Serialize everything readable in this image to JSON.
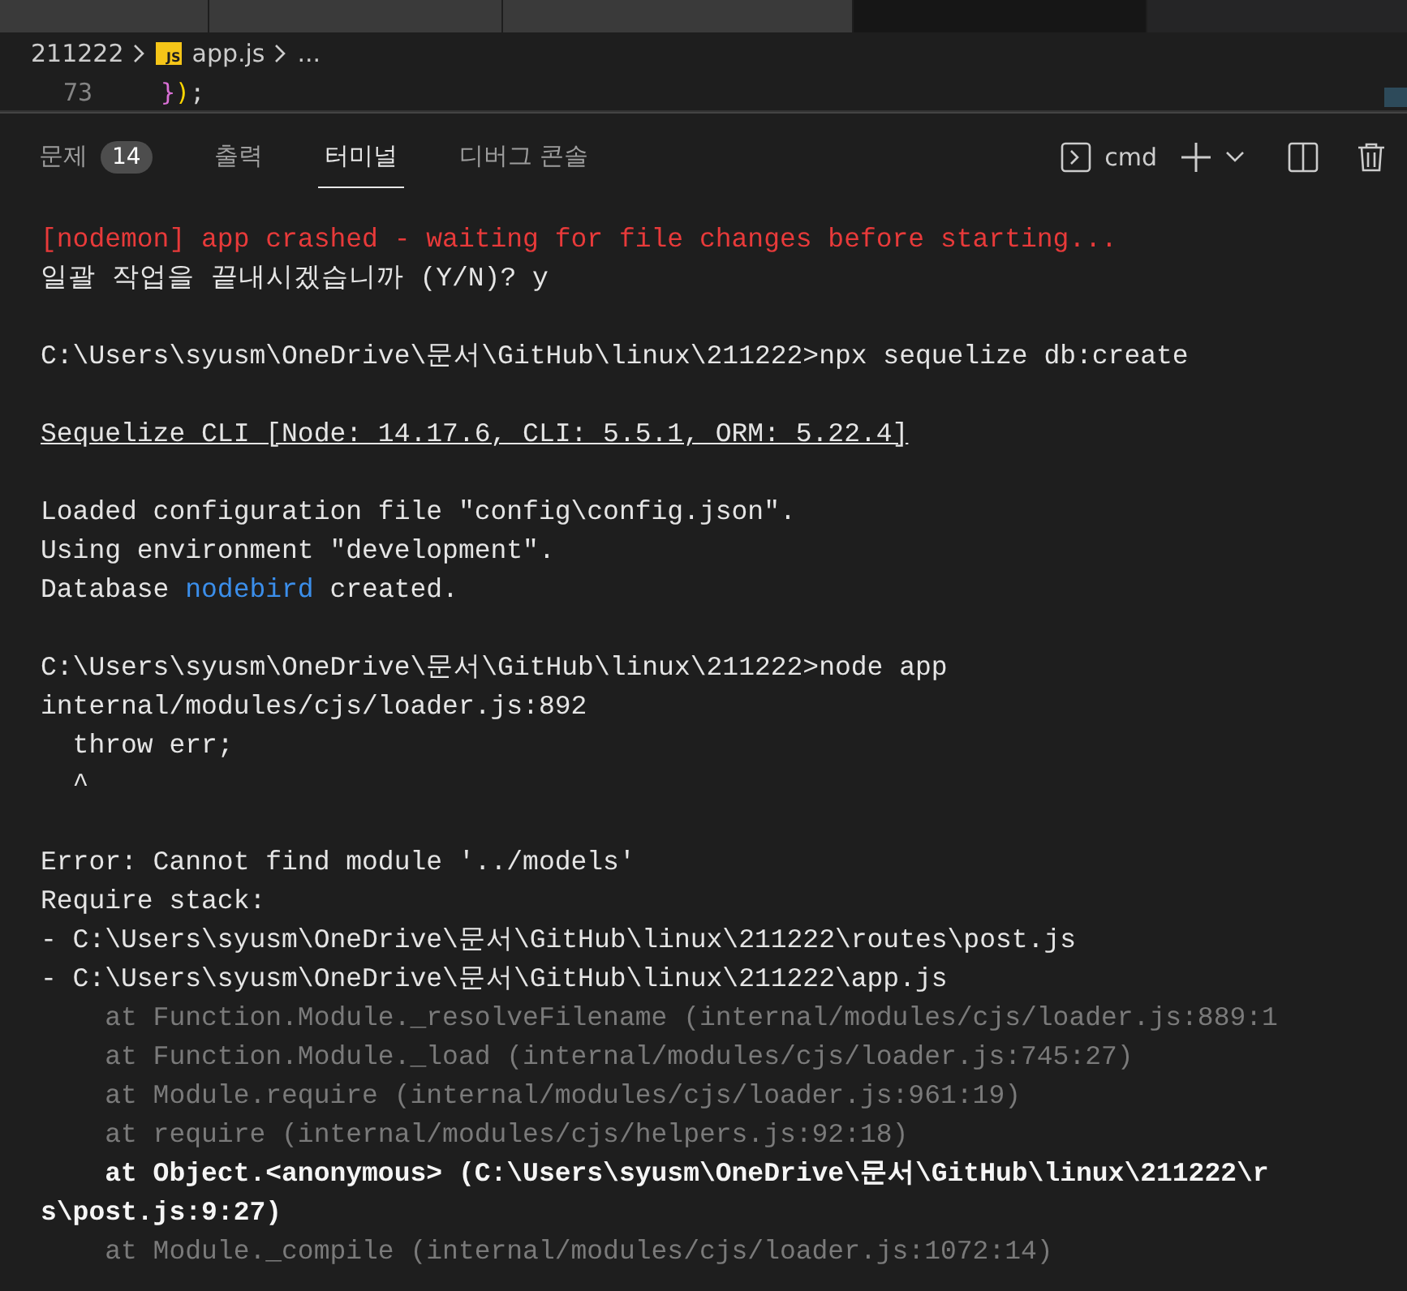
{
  "editor_tabs": [
    {
      "selected": false
    },
    {
      "selected": false
    },
    {
      "selected": false
    },
    {
      "selected": true
    }
  ],
  "breadcrumb": {
    "folder": "211222",
    "file_icon": "JS",
    "file": "app.js",
    "more": "..."
  },
  "code": {
    "line_number": "73",
    "tokens": [
      {
        "text": "}",
        "kind": "brace"
      },
      {
        "text": ")",
        "kind": "paren"
      },
      {
        "text": ";",
        "kind": "plain"
      }
    ]
  },
  "panel_tabs": [
    {
      "label": "문제",
      "badge": "14",
      "selected": false
    },
    {
      "label": "출력",
      "selected": false
    },
    {
      "label": "터미널",
      "selected": true
    },
    {
      "label": "디버그 콘솔",
      "selected": false
    }
  ],
  "terminal_toolbar": {
    "shell": "cmd"
  },
  "terminal_lines": [
    {
      "segments": [
        {
          "text": "[nodemon] app crashed - waiting for file changes before starting...",
          "kind": "error"
        }
      ]
    },
    {
      "segments": [
        {
          "text": "일괄 작업을 끝내시겠습니까 (Y/N)? y",
          "kind": "normal"
        }
      ]
    },
    {
      "kind": "blank"
    },
    {
      "segments": [
        {
          "text": "C:\\Users\\syusm\\OneDrive\\문서\\GitHub\\linux\\211222>npx sequelize db:create",
          "kind": "normal"
        }
      ]
    },
    {
      "kind": "blank"
    },
    {
      "segments": [
        {
          "text": "Sequelize CLI [Node: 14.17.6, CLI: 5.5.1, ORM: 5.22.4]",
          "kind": "underline"
        }
      ]
    },
    {
      "kind": "blank"
    },
    {
      "segments": [
        {
          "text": "Loaded configuration file \"config\\config.json\".",
          "kind": "normal"
        }
      ]
    },
    {
      "segments": [
        {
          "text": "Using environment \"development\".",
          "kind": "normal"
        }
      ]
    },
    {
      "segments": [
        {
          "text": "Database ",
          "kind": "normal"
        },
        {
          "text": "nodebird",
          "kind": "link"
        },
        {
          "text": " created.",
          "kind": "normal"
        }
      ]
    },
    {
      "kind": "blank"
    },
    {
      "segments": [
        {
          "text": "C:\\Users\\syusm\\OneDrive\\문서\\GitHub\\linux\\211222>node app",
          "kind": "normal"
        }
      ]
    },
    {
      "segments": [
        {
          "text": "internal/modules/cjs/loader.js:892",
          "kind": "normal"
        }
      ]
    },
    {
      "segments": [
        {
          "text": "  throw err;",
          "kind": "normal"
        }
      ]
    },
    {
      "segments": [
        {
          "text": "  ^",
          "kind": "normal"
        }
      ]
    },
    {
      "kind": "blank"
    },
    {
      "segments": [
        {
          "text": "Error: Cannot find module '../models'",
          "kind": "normal"
        }
      ]
    },
    {
      "segments": [
        {
          "text": "Require stack:",
          "kind": "normal"
        }
      ]
    },
    {
      "segments": [
        {
          "text": "- C:\\Users\\syusm\\OneDrive\\문서\\GitHub\\linux\\211222\\routes\\post.js",
          "kind": "normal"
        }
      ]
    },
    {
      "segments": [
        {
          "text": "- C:\\Users\\syusm\\OneDrive\\문서\\GitHub\\linux\\211222\\app.js",
          "kind": "normal"
        }
      ]
    },
    {
      "segments": [
        {
          "text": "    at Function.Module._resolveFilename (internal/modules/cjs/loader.js:889:1",
          "kind": "dim"
        }
      ]
    },
    {
      "segments": [
        {
          "text": "    at Function.Module._load (internal/modules/cjs/loader.js:745:27)",
          "kind": "dim"
        }
      ]
    },
    {
      "segments": [
        {
          "text": "    at Module.require (internal/modules/cjs/loader.js:961:19)",
          "kind": "dim"
        }
      ]
    },
    {
      "segments": [
        {
          "text": "    at require (internal/modules/cjs/helpers.js:92:18)",
          "kind": "dim"
        }
      ]
    },
    {
      "segments": [
        {
          "text": "    at Object.<anonymous> (C:\\Users\\syusm\\OneDrive\\문서\\GitHub\\linux\\211222\\r",
          "kind": "bold"
        }
      ]
    },
    {
      "segments": [
        {
          "text": "s\\post.js:9:27)",
          "kind": "bold"
        }
      ]
    },
    {
      "segments": [
        {
          "text": "    at Module._compile (internal/modules/cjs/loader.js:1072:14)",
          "kind": "dim"
        }
      ]
    }
  ]
}
